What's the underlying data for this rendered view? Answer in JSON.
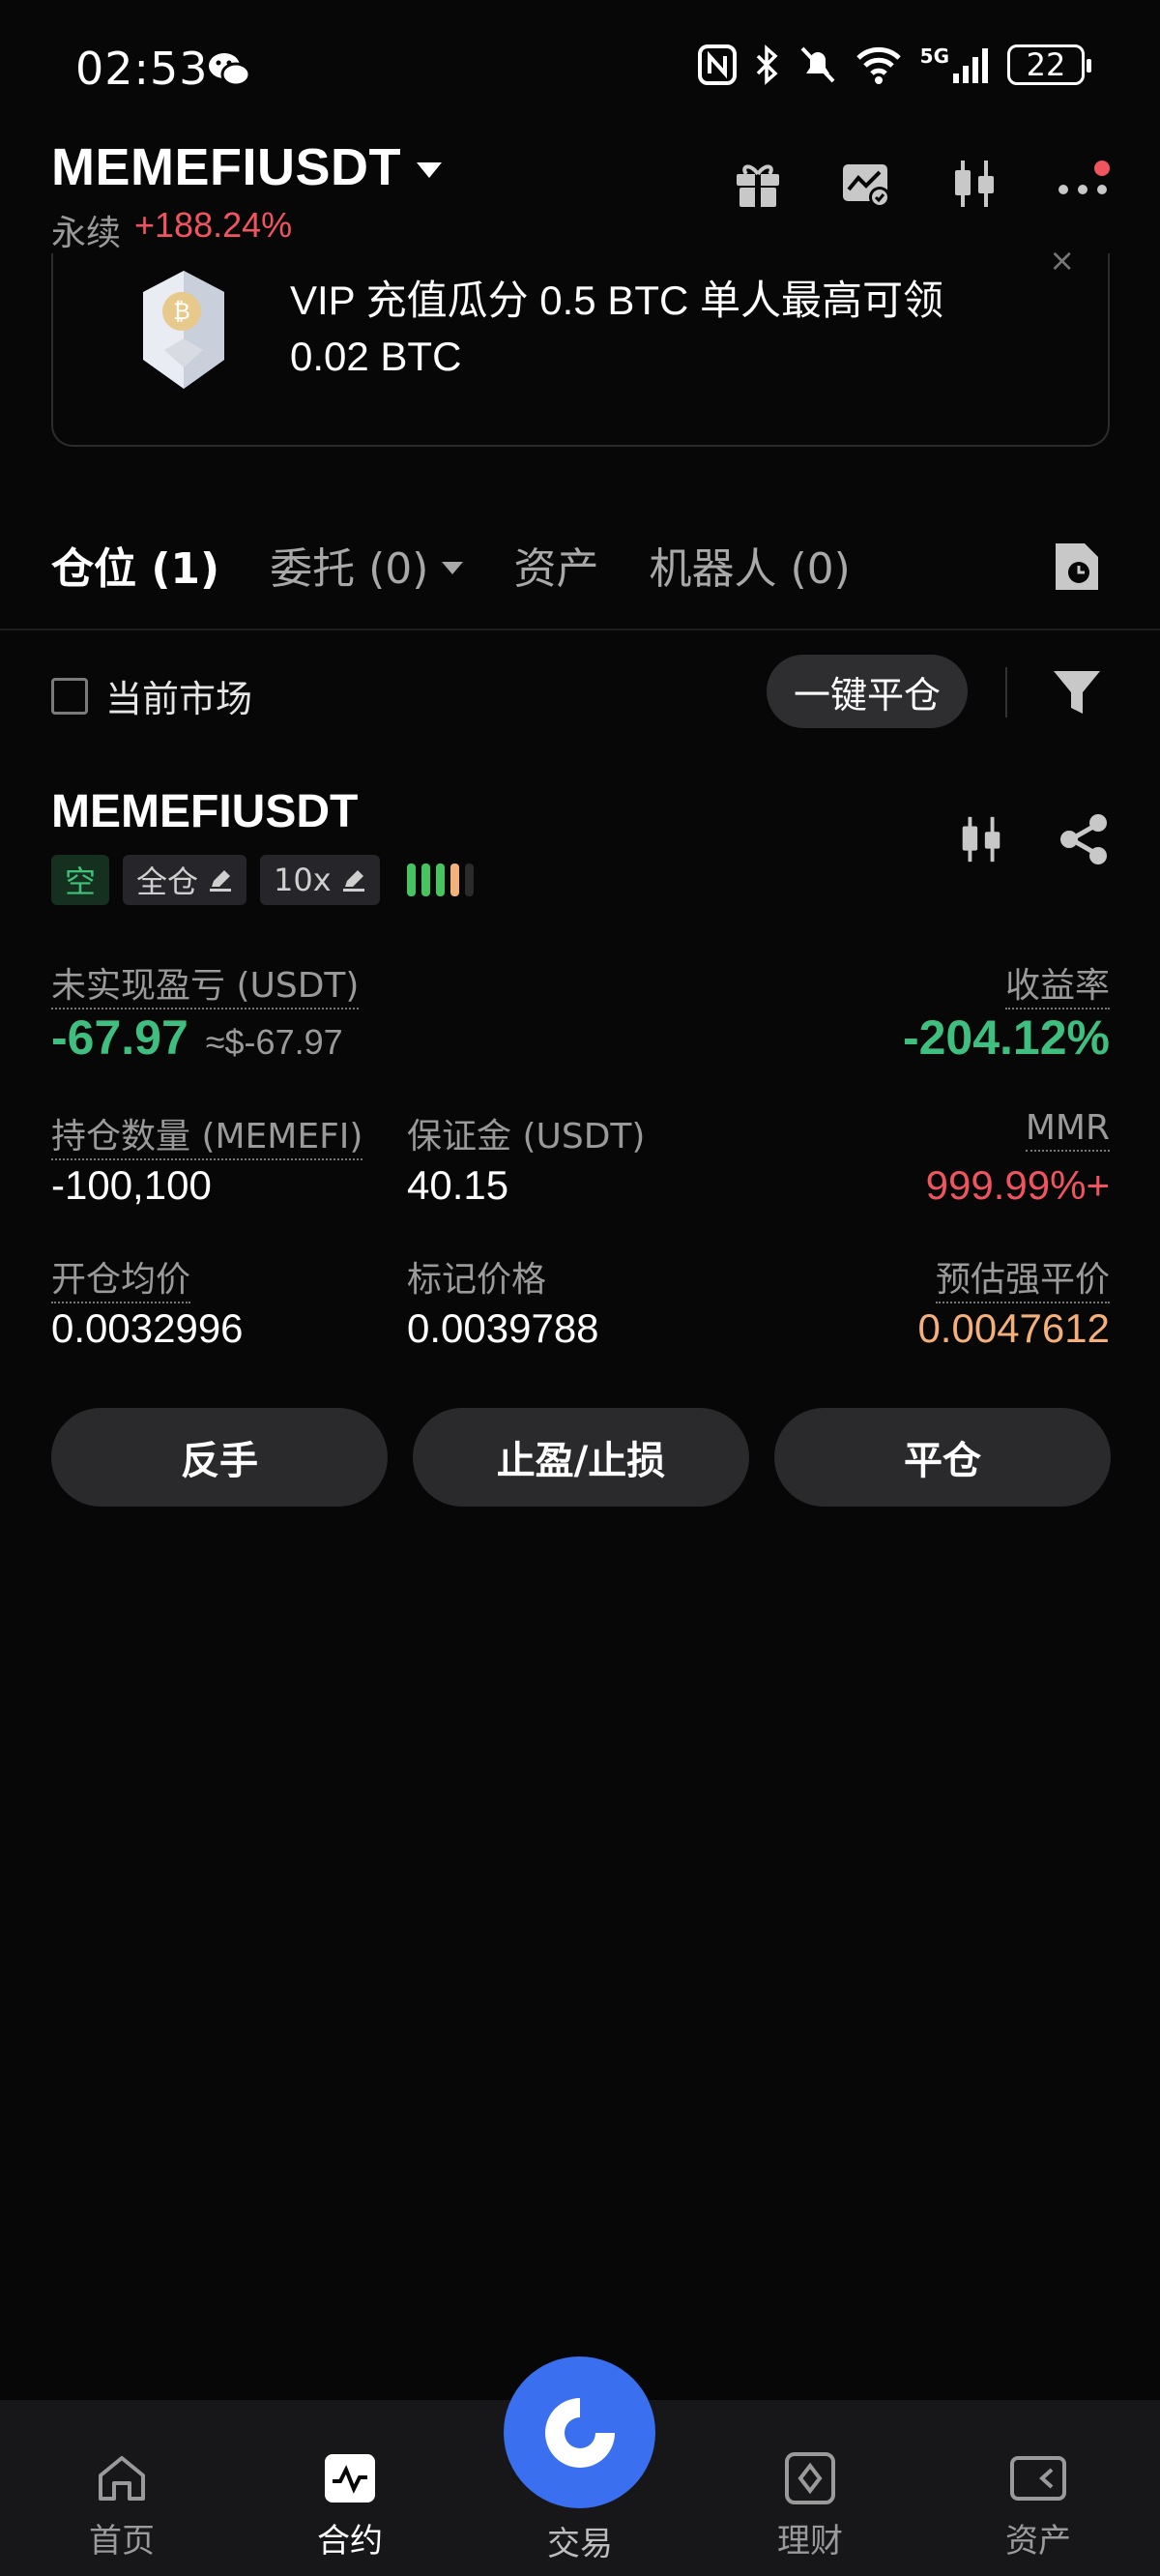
{
  "status_bar": {
    "time": "02:53",
    "network": "5G",
    "battery": "22"
  },
  "header": {
    "pair": "MEMEFIUSDT",
    "contract_type": "永续",
    "change_pct": "+188.24%"
  },
  "banner": {
    "text": "VIP 充值瓜分 0.5 BTC 单人最高可领 0.02 BTC",
    "close": "×"
  },
  "tabs": [
    {
      "label": "仓位 (1)"
    },
    {
      "label": "委托 (0)"
    },
    {
      "label": "资产"
    },
    {
      "label": "机器人 (0)"
    }
  ],
  "filter": {
    "current_market_label": "当前市场",
    "close_all_label": "一键平仓"
  },
  "position": {
    "symbol": "MEMEFIUSDT",
    "side_tag": "空",
    "margin_mode_tag": "全仓",
    "leverage_tag": "10x",
    "risk_colors": [
      "#45c45f",
      "#45c45f",
      "#45c45f",
      "#f2b27a",
      "#2a2a2a"
    ],
    "unrealized_pnl_label": "未实现盈亏 (USDT)",
    "unrealized_pnl": "-67.97",
    "unrealized_pnl_usd": "≈$-67.97",
    "roe_label": "收益率",
    "roe": "-204.12%",
    "size_label": "持仓数量 (MEMEFI)",
    "size": "-100,100",
    "margin_label": "保证金 (USDT)",
    "margin": "40.15",
    "mmr_label": "MMR",
    "mmr": "999.99%+",
    "entry_label": "开仓均价",
    "entry": "0.0032996",
    "mark_label": "标记价格",
    "mark": "0.0039788",
    "liq_label": "预估强平价",
    "liq": "0.0047612"
  },
  "actions": {
    "reverse": "反手",
    "tpsl": "止盈/止损",
    "close": "平仓"
  },
  "bottom_nav": {
    "home": "首页",
    "futures": "合约",
    "trade": "交易",
    "earn": "理财",
    "assets": "资产"
  },
  "colors": {
    "accent_blue": "#3a70f0",
    "profit_green": "#3fbf7f",
    "loss_red": "#f0555f",
    "liq_orange": "#f5b07a"
  }
}
